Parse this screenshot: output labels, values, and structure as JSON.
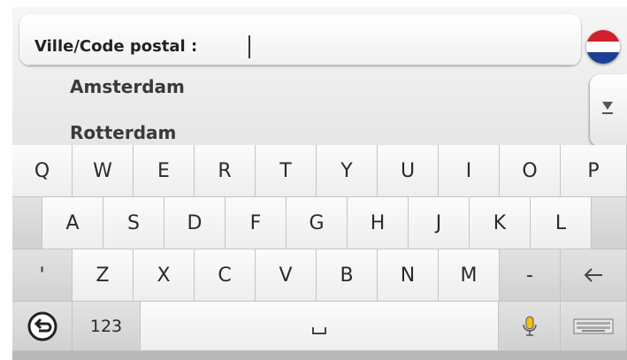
{
  "search": {
    "label": "Ville/Code postal :",
    "value": "",
    "placeholder": ""
  },
  "country_flag": {
    "icon": "netherlands-flag-icon",
    "colors": [
      "#d0202e",
      "#ffffff",
      "#1d3f93"
    ]
  },
  "results": [
    "Amsterdam",
    "Rotterdam"
  ],
  "scroll": {
    "icon": "scroll-down-icon"
  },
  "keyboard": {
    "row1": [
      "Q",
      "W",
      "E",
      "R",
      "T",
      "Y",
      "U",
      "I",
      "O",
      "P"
    ],
    "row2": [
      "A",
      "S",
      "D",
      "F",
      "G",
      "H",
      "J",
      "K",
      "L"
    ],
    "row3": [
      "'",
      "Z",
      "X",
      "C",
      "V",
      "B",
      "N",
      "M",
      "-"
    ],
    "backspace_icon": "backspace-arrow-icon",
    "back_icon": "back-icon",
    "numbers_label": "123",
    "space_icon": "space-icon",
    "voice_icon": "microphone-icon",
    "keyboard_switch_icon": "keyboard-icon"
  }
}
